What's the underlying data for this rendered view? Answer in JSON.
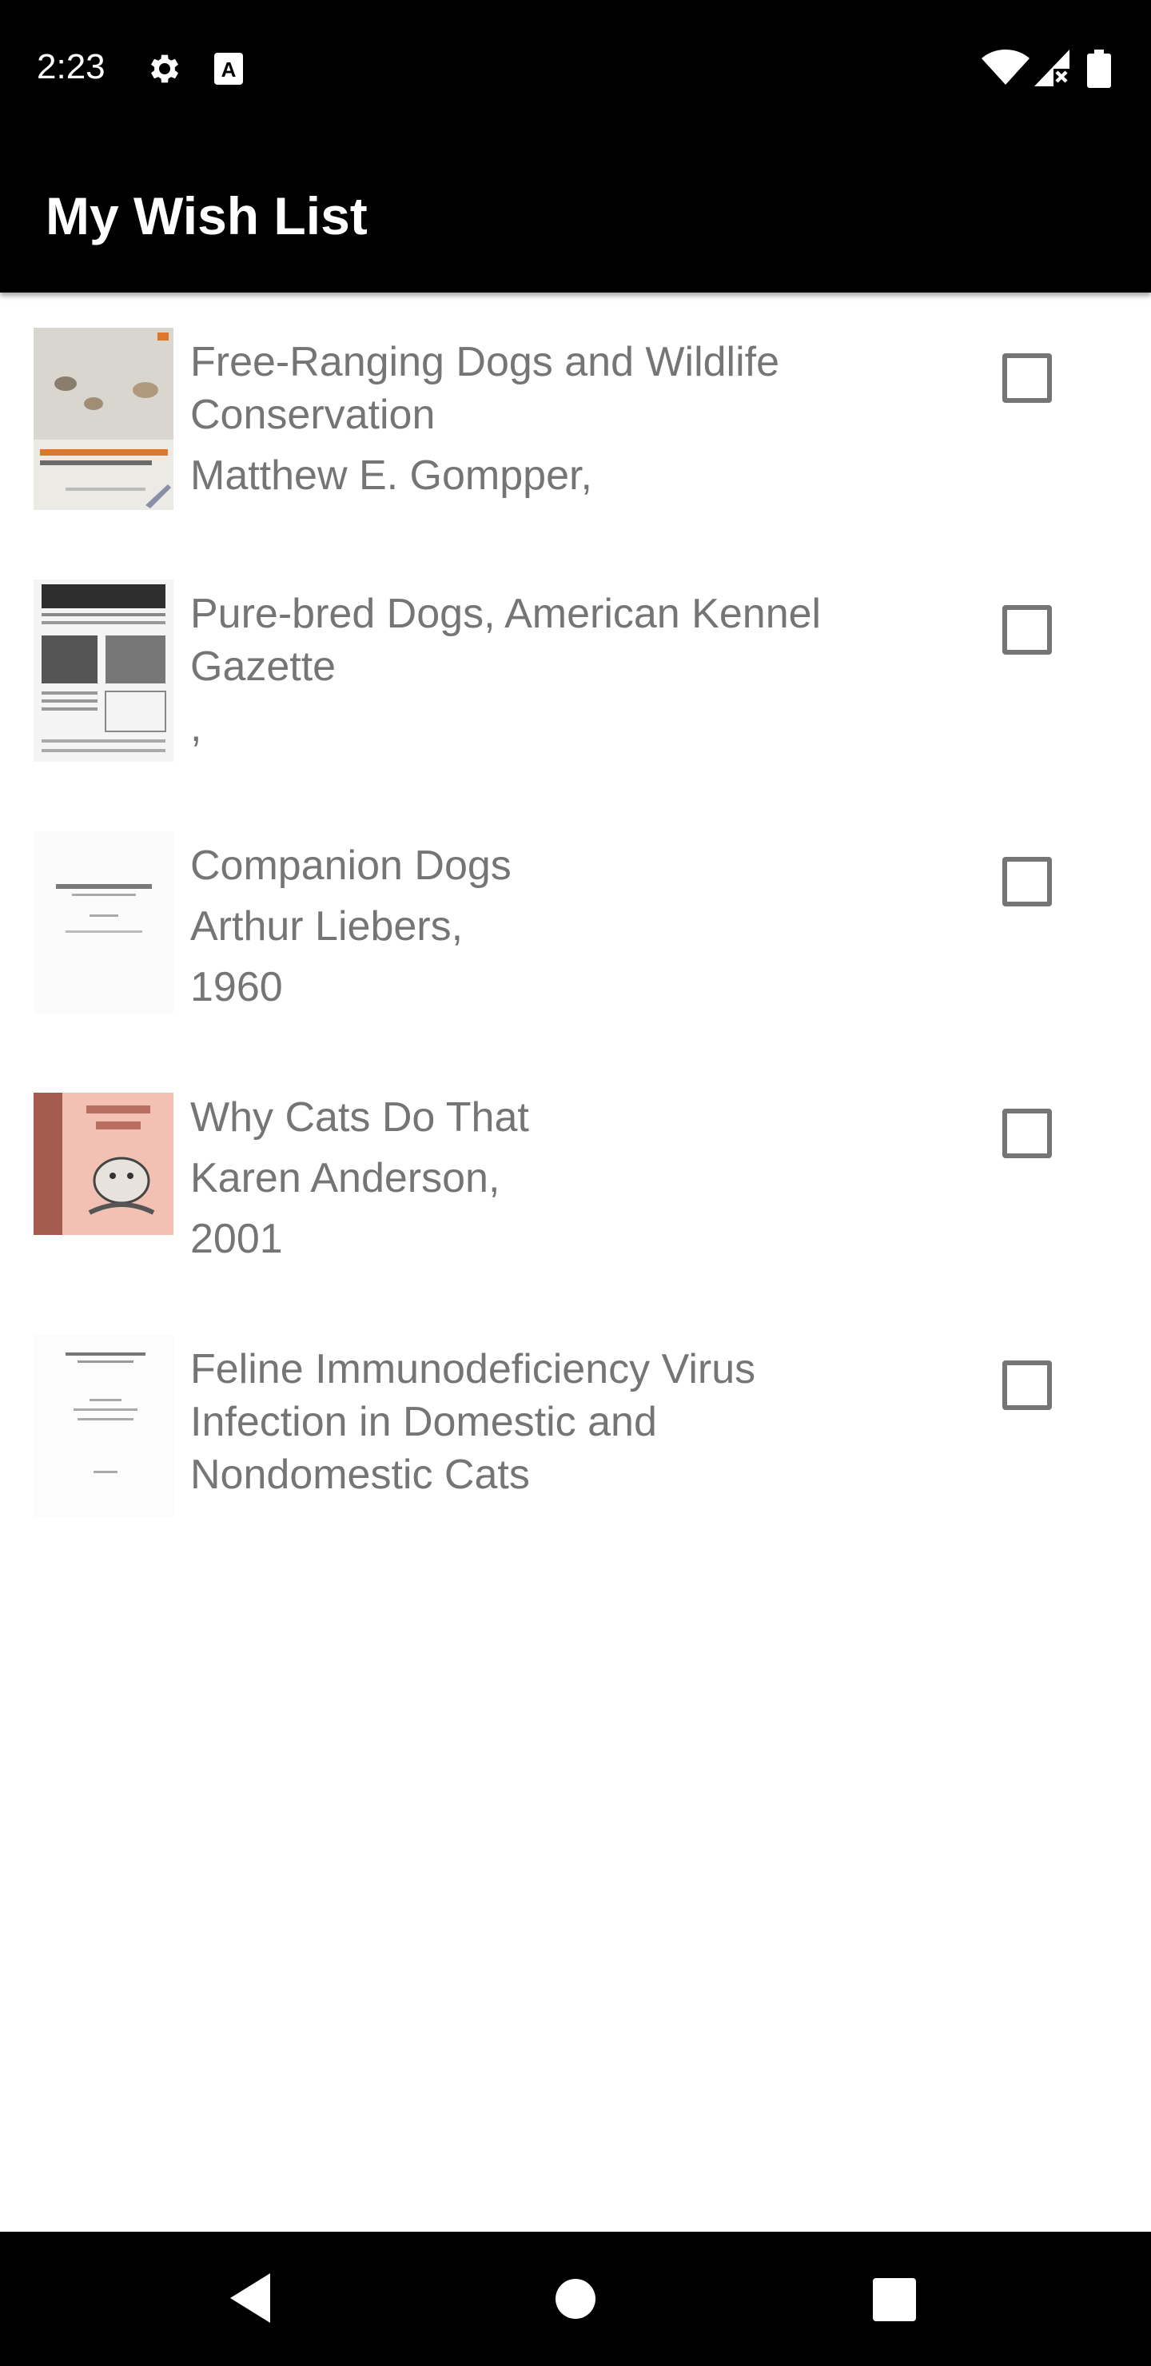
{
  "status_bar": {
    "time": "2:23",
    "icons": [
      "gear-icon",
      "text-a-icon",
      "wifi-icon",
      "signal-icon",
      "battery-icon"
    ]
  },
  "app_bar": {
    "title": "My Wish List"
  },
  "books": [
    {
      "title": "Free-Ranging Dogs and Wildlife Conservation",
      "author": "Matthew E. Gompper,",
      "year": "",
      "checked": false
    },
    {
      "title": "Pure-bred Dogs, American Kennel Gazette",
      "author": ",",
      "year": "",
      "checked": false
    },
    {
      "title": "Companion Dogs",
      "author": "Arthur Liebers,",
      "year": "1960",
      "checked": false
    },
    {
      "title": "Why Cats Do That",
      "author": "Karen Anderson,",
      "year": "2001",
      "checked": false
    },
    {
      "title": "Feline Immunodeficiency Virus Infection in Domestic and Nondomestic Cats",
      "author": "",
      "year": "",
      "checked": false
    }
  ],
  "nav_bar": {
    "icons": [
      "back-icon",
      "home-icon",
      "recents-icon"
    ]
  },
  "colors": {
    "bar_background": "#000000",
    "text_secondary": "#757575",
    "background": "#ffffff"
  }
}
